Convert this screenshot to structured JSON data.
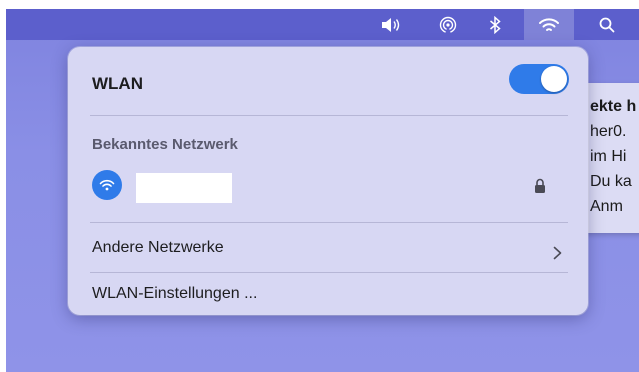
{
  "menubar": {
    "icons": [
      "volume-icon",
      "airdrop-icon",
      "bluetooth-icon",
      "wifi-icon",
      "search-icon"
    ]
  },
  "background_window": {
    "lines": [
      "ekte h",
      "her0.",
      "im Hi",
      "Du ka",
      "Anm"
    ]
  },
  "wlan_panel": {
    "title": "WLAN",
    "toggle_on": true,
    "known_network_label": "Bekanntes Netzwerk",
    "known_network_name": "",
    "other_networks_label": "Andere Netzwerke",
    "settings_label": "WLAN-Einstellungen ..."
  },
  "colors": {
    "menubar": "#5c5fcc",
    "accent": "#2f7be9",
    "panel": "#d7d7f3"
  }
}
